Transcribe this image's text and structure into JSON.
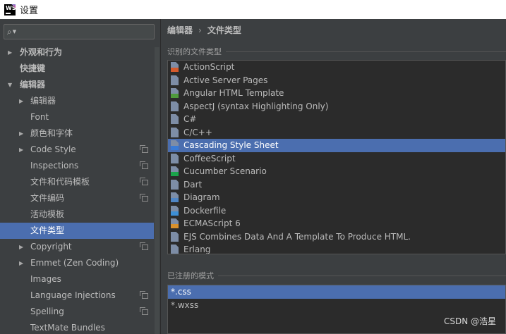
{
  "window": {
    "title": "设置",
    "logo_text": "WS"
  },
  "search": {
    "glyph": "⌕",
    "value": "",
    "placeholder": ""
  },
  "sidebar": {
    "items": [
      {
        "label": "外观和行为",
        "level": 0,
        "arrow": "right",
        "bold": true,
        "selected": false,
        "copy": false
      },
      {
        "label": "快捷键",
        "level": 0,
        "arrow": "none",
        "bold": true,
        "selected": false,
        "copy": false
      },
      {
        "label": "编辑器",
        "level": 0,
        "arrow": "down",
        "bold": true,
        "selected": false,
        "copy": false
      },
      {
        "label": "编辑器",
        "level": 1,
        "arrow": "right",
        "bold": false,
        "selected": false,
        "copy": false
      },
      {
        "label": "Font",
        "level": 1,
        "arrow": "none",
        "bold": false,
        "selected": false,
        "copy": false
      },
      {
        "label": "颜色和字体",
        "level": 1,
        "arrow": "right",
        "bold": false,
        "selected": false,
        "copy": false
      },
      {
        "label": "Code Style",
        "level": 1,
        "arrow": "right",
        "bold": false,
        "selected": false,
        "copy": true
      },
      {
        "label": "Inspections",
        "level": 1,
        "arrow": "none",
        "bold": false,
        "selected": false,
        "copy": true
      },
      {
        "label": "文件和代码模板",
        "level": 1,
        "arrow": "none",
        "bold": false,
        "selected": false,
        "copy": true
      },
      {
        "label": "文件编码",
        "level": 1,
        "arrow": "none",
        "bold": false,
        "selected": false,
        "copy": true
      },
      {
        "label": "活动模板",
        "level": 1,
        "arrow": "none",
        "bold": false,
        "selected": false,
        "copy": false
      },
      {
        "label": "文件类型",
        "level": 1,
        "arrow": "none",
        "bold": false,
        "selected": true,
        "copy": false
      },
      {
        "label": "Copyright",
        "level": 1,
        "arrow": "right",
        "bold": false,
        "selected": false,
        "copy": true
      },
      {
        "label": "Emmet (Zen Coding)",
        "level": 1,
        "arrow": "right",
        "bold": false,
        "selected": false,
        "copy": false
      },
      {
        "label": "Images",
        "level": 1,
        "arrow": "none",
        "bold": false,
        "selected": false,
        "copy": false
      },
      {
        "label": "Language Injections",
        "level": 1,
        "arrow": "none",
        "bold": false,
        "selected": false,
        "copy": true
      },
      {
        "label": "Spelling",
        "level": 1,
        "arrow": "none",
        "bold": false,
        "selected": false,
        "copy": true
      },
      {
        "label": "TextMate Bundles",
        "level": 1,
        "arrow": "none",
        "bold": false,
        "selected": false,
        "copy": false
      }
    ]
  },
  "breadcrumb": {
    "first": "编辑器",
    "separator": "›",
    "second": "文件类型"
  },
  "recognized": {
    "title": "识别的文件类型",
    "items": [
      {
        "label": "ActionScript",
        "icon": "actionscript-file-icon",
        "color": "#d55a2c",
        "selected": false
      },
      {
        "label": "Active Server Pages",
        "icon": "asp-file-icon",
        "color": "#7d8da6",
        "selected": false
      },
      {
        "label": "Angular HTML Template",
        "icon": "angular-html-file-icon",
        "color": "#4e9a3c",
        "selected": false
      },
      {
        "label": "AspectJ (syntax Highlighting Only)",
        "icon": "aspectj-file-icon",
        "color": "#7d8da6",
        "selected": false
      },
      {
        "label": "C#",
        "icon": "csharp-file-icon",
        "color": "#7d8da6",
        "selected": false
      },
      {
        "label": "C/C++",
        "icon": "cpp-file-icon",
        "color": "#7d8da6",
        "selected": false
      },
      {
        "label": "Cascading Style Sheet",
        "icon": "css-file-icon",
        "color": "#3a7bd5",
        "selected": true
      },
      {
        "label": "CoffeeScript",
        "icon": "coffeescript-file-icon",
        "color": "#7d8da6",
        "selected": false
      },
      {
        "label": "Cucumber Scenario",
        "icon": "cucumber-icon",
        "color": "#1aa34a",
        "selected": false
      },
      {
        "label": "Dart",
        "icon": "dart-file-icon",
        "color": "#7d8da6",
        "selected": false
      },
      {
        "label": "Diagram",
        "icon": "diagram-icon",
        "color": "#4f86c6",
        "selected": false
      },
      {
        "label": "Dockerfile",
        "icon": "dockerfile-icon",
        "color": "#3d8fd6",
        "selected": false
      },
      {
        "label": "ECMAScript 6",
        "icon": "ecmascript6-file-icon",
        "color": "#d8902c",
        "selected": false
      },
      {
        "label": "EJS Combines Data And A Template To Produce HTML.",
        "icon": "ejs-file-icon",
        "color": "#7d8da6",
        "selected": false
      },
      {
        "label": "Erlang",
        "icon": "erlang-file-icon",
        "color": "#7d8da6",
        "selected": false
      }
    ]
  },
  "patterns": {
    "title": "已注册的模式",
    "items": [
      {
        "label": "*.css",
        "selected": true
      },
      {
        "label": "*.wxss",
        "selected": false
      }
    ]
  },
  "watermark": "CSDN @浩星"
}
